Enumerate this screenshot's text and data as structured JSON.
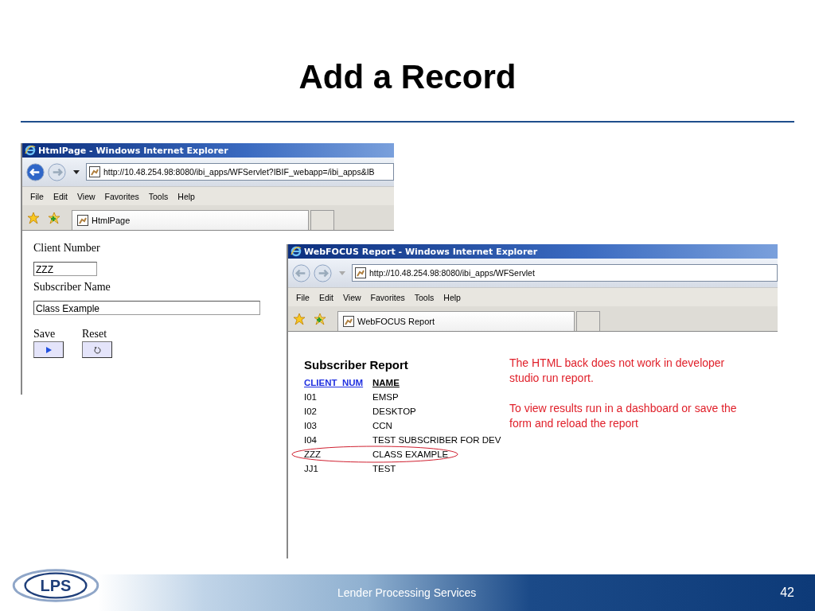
{
  "title": "Add a Record",
  "windows": [
    {
      "kind": "form",
      "title": "HtmlPage - Windows Internet Explorer",
      "back_enabled": true,
      "address": "http://10.48.254.98:8080/ibi_apps/WFServlet?IBIF_webapp=/ibi_apps&IB",
      "menu": [
        "File",
        "Edit",
        "View",
        "Favorites",
        "Tools",
        "Help"
      ],
      "tab": "HtmlPage",
      "fields": [
        {
          "label": "Client Number",
          "value": "ZZZ",
          "kind": "code"
        },
        {
          "label": "Subscriber Name",
          "value": "Class Example",
          "kind": "name"
        }
      ],
      "buttons": [
        {
          "label": "Save",
          "kind": "play"
        },
        {
          "label": "Reset",
          "kind": "reset"
        }
      ]
    },
    {
      "kind": "report",
      "title": "WebFOCUS Report - Windows Internet Explorer",
      "back_enabled": false,
      "address": "http://10.48.254.98:8080/ibi_apps/WFServlet",
      "menu": [
        "File",
        "Edit",
        "View",
        "Favorites",
        "Tools",
        "Help"
      ],
      "tab": "WebFOCUS Report",
      "report_title": "Subscriber Report",
      "columns": [
        {
          "label": "CLIENT_NUM",
          "link": true
        },
        {
          "label": "NAME",
          "link": false
        }
      ],
      "rows": [
        {
          "cells": [
            "I01",
            "EMSP"
          ],
          "circled": false
        },
        {
          "cells": [
            "I02",
            "DESKTOP"
          ],
          "circled": false
        },
        {
          "cells": [
            "I03",
            "CCN"
          ],
          "circled": false
        },
        {
          "cells": [
            "I04",
            "TEST SUBSCRIBER FOR DEV"
          ],
          "circled": false
        },
        {
          "cells": [
            "ZZZ",
            "CLASS EXAMPLE"
          ],
          "circled": true
        },
        {
          "cells": [
            "JJ1",
            "TEST"
          ],
          "circled": false
        }
      ],
      "notes": [
        "The HTML back does not work in developer studio run report.",
        "To view results run in a dashboard or save the form and reload the report"
      ]
    }
  ],
  "footer": {
    "logo": "LPS",
    "company": "Lender Processing Services",
    "page": "42"
  }
}
